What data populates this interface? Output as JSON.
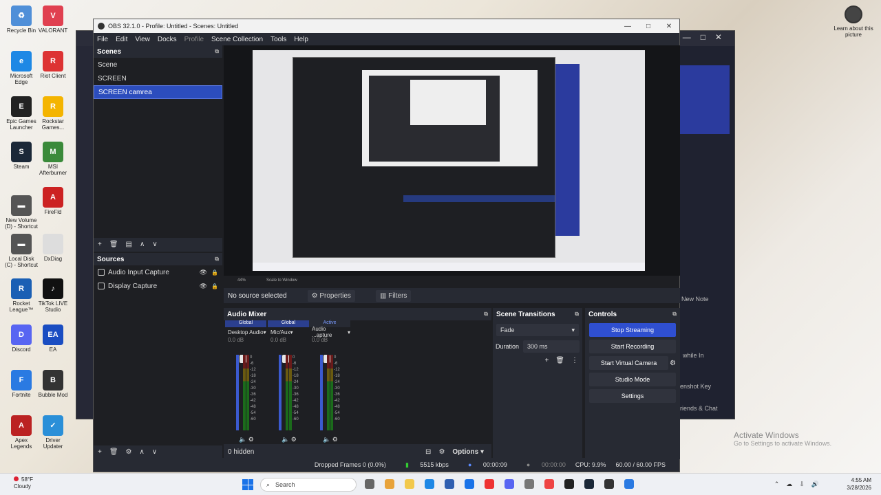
{
  "desktop": {
    "icons": [
      {
        "label": "Recycle Bin",
        "color": "#4f8fd8",
        "glyph": "♻"
      },
      {
        "label": "VALORANT",
        "color": "#e04050",
        "glyph": "V"
      },
      {
        "label": "Microsoft Edge",
        "color": "#1e88e5",
        "glyph": "e"
      },
      {
        "label": "Riot Client",
        "color": "#d33",
        "glyph": "R"
      },
      {
        "label": "Epic Games Launcher",
        "color": "#222",
        "glyph": "E"
      },
      {
        "label": "Rockstar Games...",
        "color": "#f4b400",
        "glyph": "R"
      },
      {
        "label": "Steam",
        "color": "#1b2838",
        "glyph": "S"
      },
      {
        "label": "MSI Afterburner",
        "color": "#3a8a3a",
        "glyph": "M"
      },
      {
        "label": "New Volume (D) - Shortcut",
        "color": "#555",
        "glyph": "▬"
      },
      {
        "label": "FireFld",
        "color": "#c22",
        "glyph": "A"
      },
      {
        "label": "Local Disk (C) - Shortcut",
        "color": "#555",
        "glyph": "▬"
      },
      {
        "label": "DxDiag",
        "color": "#ddd",
        "glyph": ""
      },
      {
        "label": "Rocket League™",
        "color": "#1a5fb4",
        "glyph": "R"
      },
      {
        "label": "TikTok LIVE Studio",
        "color": "#111",
        "glyph": "♪"
      },
      {
        "label": "Discord",
        "color": "#5865f2",
        "glyph": "D"
      },
      {
        "label": "EA",
        "color": "#1a4dc2",
        "glyph": "EA"
      },
      {
        "label": "Fortnite",
        "color": "#2a7ae2",
        "glyph": "F"
      },
      {
        "label": "Bubble Mod",
        "color": "#333",
        "glyph": "B"
      },
      {
        "label": "Apex Legends",
        "color": "#b22",
        "glyph": "A"
      },
      {
        "label": "Driver Updater",
        "color": "#2a8fd8",
        "glyph": "✓"
      }
    ],
    "learn_label": "Learn about this picture",
    "activate": {
      "title": "Activate Windows",
      "subtitle": "Go to Settings to activate Windows."
    },
    "bg_window_texts": {
      "new_note": "New Note",
      "while_in": "while In",
      "snapshot_key": "enshot Key",
      "friends_chat": "riends & Chat"
    }
  },
  "obs": {
    "title": "OBS 32.1.0 - Profile: Untitled - Scenes: Untitled",
    "menu": [
      "File",
      "Edit",
      "View",
      "Docks",
      "Profile",
      "Scene Collection",
      "Tools",
      "Help"
    ],
    "scenes": {
      "header": "Scenes",
      "items": [
        "Scene",
        "SCREEN",
        "SCREEN camrea"
      ],
      "selected": 2
    },
    "sources": {
      "header": "Sources",
      "items": [
        "Audio Input Capture",
        "Display Capture"
      ]
    },
    "preview": {
      "zoom": "44%",
      "scale_mode": "Scale to Window"
    },
    "context": {
      "no_source": "No source selected",
      "properties": "Properties",
      "filters": "Filters"
    },
    "mixer": {
      "header": "Audio Mixer",
      "strips": [
        {
          "tag": "Global",
          "name": "Desktop Audio",
          "db": "0.0 dB"
        },
        {
          "tag": "Global",
          "name": "Mic/Aux",
          "db": "0.0 dB"
        },
        {
          "tag": "Active",
          "name": "Audio ...apture",
          "db": "0.0 dB"
        }
      ],
      "scale": [
        "0",
        "-6",
        "-12",
        "-18",
        "-24",
        "-30",
        "-36",
        "-42",
        "-48",
        "-54",
        "-60"
      ],
      "hidden": "0 hidden",
      "options": "Options"
    },
    "transitions": {
      "header": "Scene Transitions",
      "type": "Fade",
      "duration_label": "Duration",
      "duration": "300 ms"
    },
    "controls": {
      "header": "Controls",
      "buttons": [
        "Stop Streaming",
        "Start Recording",
        "Start Virtual Camera",
        "Studio Mode",
        "Settings"
      ]
    },
    "status": {
      "dropped": "Dropped Frames 0 (0.0%)",
      "kbps": "5515 kbps",
      "stream_time": "00:00:09",
      "rec_time": "00:00:00",
      "cpu": "CPU: 9.9%",
      "fps": "60.00 / 60.00 FPS"
    }
  },
  "taskbar": {
    "weather_temp": "58°F",
    "weather_desc": "Cloudy",
    "search": "Search",
    "time": "4:55 AM",
    "date": "3/28/2026",
    "app_colors": [
      "#666",
      "#e8a33a",
      "#f2c94c",
      "#1e88e5",
      "#2f5fb0",
      "#1a73e8",
      "#e33",
      "#5865f2",
      "#777",
      "#e44",
      "#222",
      "#1b2838",
      "#333",
      "#2a7ae2"
    ]
  }
}
